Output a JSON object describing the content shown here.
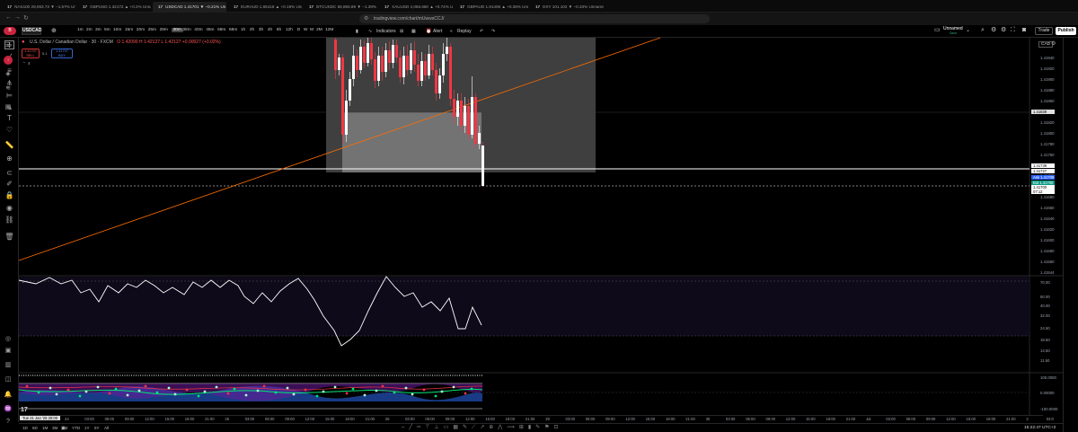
{
  "browser": {
    "tabs": [
      "NAS100 29,063.73 ▼ −1.57% Unnam...",
      "GBPUSD 1.32172 ▲ +0.2% Unnamed",
      "USDCAD 1.41701 ▼ −0.21% Un...",
      "EURAUD 1.65418 ▲ +0.19% Unnam...",
      "BTCUSDC 58,855.89 ▼ −1.39% Unna...",
      "XAUUSD 4,056.660 ▲ +0.74% Unna...",
      "GBPAUD 1.91406 ▲ +0.36% Unnam...",
      "DXY 101.102 ▼ −0.33% Unnamed"
    ],
    "url": "tradingview.com/chart/mUwwsCCJ/"
  },
  "toolbar": {
    "symbol": "USDCAD",
    "timeframes": [
      "1m",
      "2m",
      "3m",
      "5m",
      "10m",
      "15m",
      "20m",
      "25m",
      "28m",
      "30m",
      "38m",
      "40m",
      "45m",
      "58m",
      "68m",
      "1h",
      "2h",
      "3h",
      "4h",
      "6h",
      "12h",
      "D",
      "W",
      "M",
      "2M",
      "12M"
    ],
    "active_timeframe": "30m",
    "indicators_label": "Indicators",
    "alert_label": "Alert",
    "replay_label": "Replay",
    "layout_name": "Unnamed",
    "layout_sub": "Save",
    "trade_label": "Trade",
    "publish_label": "Publish"
  },
  "legend": {
    "title": "U.S. Dollar / Canadian Dollar · 30 · FXCM",
    "ohlc": "O 1.42090 H 1.42127 L 1.42127 +0.00027 (+0.02%)",
    "sell_price": "1.41707",
    "sell_label": "SELL",
    "spread": "5.1",
    "buy_price": "1.41707",
    "buy_label": "BUY",
    "collapse_count": "4"
  },
  "price_axis": {
    "currency": "CAD",
    "labels": [
      "1.41940",
      "1.41920",
      "1.41900",
      "1.41880",
      "1.41860",
      "1.41840",
      "1.41820",
      "1.41800",
      "1.41780",
      "1.41760",
      "1.41740",
      "1.41720",
      "1.41700",
      "1.41680",
      "1.41660",
      "1.41640",
      "1.41620",
      "1.41600",
      "1.41580",
      "1.41560",
      "1.41544"
    ],
    "tags": [
      {
        "text": "1.41839",
        "bg": "#e0e0e0",
        "fg": "#000"
      },
      {
        "text": "1.41739",
        "bg": "#ffffff",
        "fg": "#000"
      },
      {
        "text": "1.41727",
        "bg": "#ffffff",
        "fg": "#000"
      },
      {
        "text": "Ask 1.41709",
        "bg": "#2962ff",
        "fg": "#fff"
      },
      {
        "text": "Bid 1.41700",
        "bg": "#089981",
        "fg": "#fff"
      },
      {
        "text": "1.41700",
        "bg": "#ffffff",
        "fg": "#000"
      },
      {
        "text": "07:12",
        "bg": "#ffffff",
        "fg": "#000"
      }
    ]
  },
  "oscillator_axis": [
    "70.00",
    "50.00",
    "40.00",
    "32.00",
    "24.50",
    "18.50",
    "14.50",
    "11.50"
  ],
  "bottom_axis": [
    "100.0000",
    "0.00000",
    "-100.0000"
  ],
  "time_axis": {
    "cursor_label": "Tue 21 Jan '26  20:00",
    "labels": [
      "24",
      "03:00",
      "06:00",
      "09:00",
      "12:00",
      "15:00",
      "18:00",
      "21:00",
      "25",
      "03:00",
      "06:00",
      "09:00",
      "12:00",
      "15:00",
      "18:00",
      "21:00",
      "26",
      "03:00",
      "06:00",
      "09:00",
      "12:00",
      "15:00",
      "18:00",
      "21:00",
      "29",
      "03:00",
      "06:00",
      "09:00",
      "12:00",
      "15:00",
      "18:00",
      "21:00",
      "30",
      "03:00",
      "06:00",
      "09:00",
      "12:00",
      "15:00",
      "18:00",
      "21:00",
      "Jul",
      "03:00",
      "06:00",
      "09:00",
      "12:00",
      "15:00",
      "18:00",
      "21:00",
      "2",
      "03:0"
    ]
  },
  "ranges": [
    "1D",
    "5D",
    "1M",
    "3M",
    "6M",
    "YTD",
    "1Y",
    "5Y",
    "All"
  ],
  "clock": "15:22:47 UTC+2",
  "colors": {
    "background": "#000000",
    "bull": "#ffffff",
    "bear": "#f23645",
    "trendline": "#ff6d00",
    "box": "#5a5a5a"
  }
}
